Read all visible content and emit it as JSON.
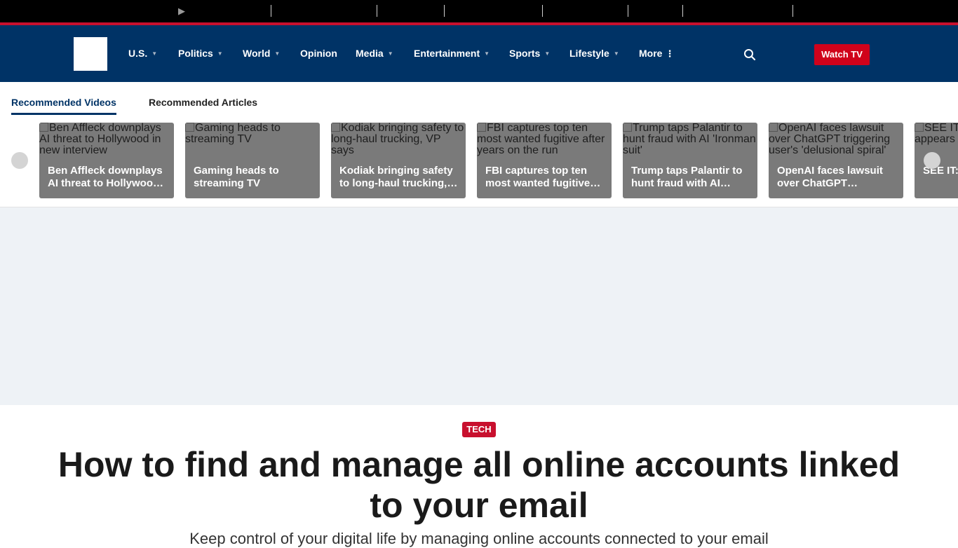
{
  "topbar": {
    "play_glyph": "▶"
  },
  "brand": {
    "logo_name": "site-logo"
  },
  "nav": {
    "items": [
      {
        "label": "U.S.",
        "dropdown": true
      },
      {
        "label": "Politics",
        "dropdown": true
      },
      {
        "label": "World",
        "dropdown": true
      },
      {
        "label": "Opinion",
        "dropdown": false
      },
      {
        "label": "Media",
        "dropdown": true
      },
      {
        "label": "Entertainment",
        "dropdown": true
      },
      {
        "label": "Sports",
        "dropdown": true
      },
      {
        "label": "Lifestyle",
        "dropdown": true
      },
      {
        "label": "More",
        "dropdown": false,
        "more": true
      }
    ],
    "watch_label": "Watch TV"
  },
  "recommend": {
    "tabs": [
      {
        "label": "Recommended Videos",
        "active": true
      },
      {
        "label": "Recommended Articles",
        "active": false
      }
    ],
    "cards": [
      {
        "alt": "Ben Affleck downplays AI threat to Hollywood in new interview",
        "title": "Ben Affleck downplays AI threat to Hollywood in new interview"
      },
      {
        "alt": "Gaming heads to streaming TV",
        "title": "Gaming heads to streaming TV"
      },
      {
        "alt": "Kodiak bringing safety to long-haul trucking, VP says",
        "title": "Kodiak bringing safety to long-haul trucking, VP says"
      },
      {
        "alt": "FBI captures top ten most wanted fugitive after years on the run",
        "title": "FBI captures top ten most wanted fugitive after years on the run"
      },
      {
        "alt": "Trump taps Palantir to hunt fraud with AI 'Ironman suit'",
        "title": "Trump taps Palantir to hunt fraud with AI 'Ironman suit'"
      },
      {
        "alt": "OpenAI faces lawsuit over ChatGPT triggering user's 'delusional spiral'",
        "title": "OpenAI faces lawsuit over ChatGPT triggering user's 'delusional spiral'"
      },
      {
        "alt": "SEE IT: ... front of ... appears",
        "title": "SEE IT: ... front of ..."
      }
    ]
  },
  "article": {
    "category": "TECH",
    "headline": "How to find and manage all online accounts linked to your email",
    "subhead": "Keep control of your digital life by managing online accounts connected to your email"
  },
  "colors": {
    "nav_bg": "#003366",
    "accent_red": "#c8102e",
    "watch_red": "#d0021b",
    "ad_bg": "#eef2f6"
  }
}
